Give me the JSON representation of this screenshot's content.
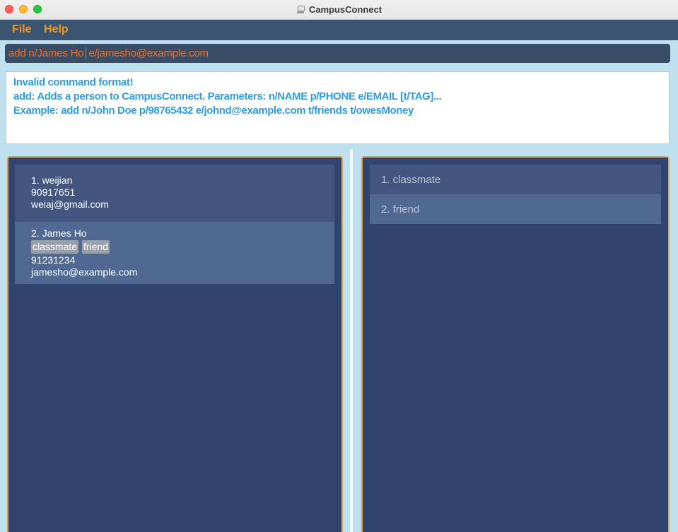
{
  "window": {
    "title": "CampusConnect"
  },
  "menu": {
    "file": "File",
    "help": "Help"
  },
  "command": {
    "text_before_caret": "add n/James Ho",
    "text_after_caret": "e/jamesho@example.com"
  },
  "result": {
    "lines": [
      "Invalid command format!",
      "add: Adds a person to CampusConnect. Parameters: n/NAME p/PHONE e/EMAIL [t/TAG]...",
      "Example: add n/John Doe p/98765432 e/johnd@example.com t/friends t/owesMoney"
    ]
  },
  "persons": [
    {
      "header": "1. weijian",
      "tags": [],
      "phone": "90917651",
      "email": "weiaj@gmail.com"
    },
    {
      "header": "2. James Ho",
      "tags": [
        "classmate",
        "friend"
      ],
      "phone": "91231234",
      "email": "jamesho@example.com"
    }
  ],
  "tag_list": [
    "1. classmate",
    "2. friend"
  ],
  "colors": {
    "menu_accent": "#f29a17",
    "command_text": "#f46c1d",
    "result_text": "#2b9ee6",
    "panel_bg": "#314470",
    "panel_border": "#e8a23c"
  }
}
